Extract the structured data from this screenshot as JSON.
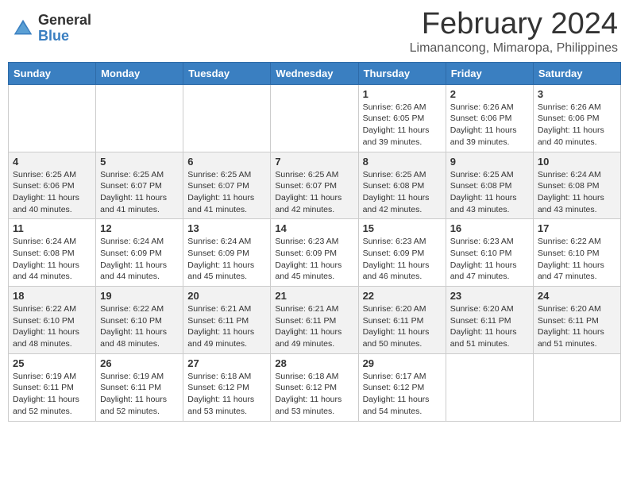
{
  "header": {
    "logo_general": "General",
    "logo_blue": "Blue",
    "title": "February 2024",
    "subtitle": "Limanancong, Mimaropa, Philippines"
  },
  "weekdays": [
    "Sunday",
    "Monday",
    "Tuesday",
    "Wednesday",
    "Thursday",
    "Friday",
    "Saturday"
  ],
  "weeks": [
    [
      {
        "day": "",
        "info": ""
      },
      {
        "day": "",
        "info": ""
      },
      {
        "day": "",
        "info": ""
      },
      {
        "day": "",
        "info": ""
      },
      {
        "day": "1",
        "info": "Sunrise: 6:26 AM\nSunset: 6:05 PM\nDaylight: 11 hours and 39 minutes."
      },
      {
        "day": "2",
        "info": "Sunrise: 6:26 AM\nSunset: 6:06 PM\nDaylight: 11 hours and 39 minutes."
      },
      {
        "day": "3",
        "info": "Sunrise: 6:26 AM\nSunset: 6:06 PM\nDaylight: 11 hours and 40 minutes."
      }
    ],
    [
      {
        "day": "4",
        "info": "Sunrise: 6:25 AM\nSunset: 6:06 PM\nDaylight: 11 hours and 40 minutes."
      },
      {
        "day": "5",
        "info": "Sunrise: 6:25 AM\nSunset: 6:07 PM\nDaylight: 11 hours and 41 minutes."
      },
      {
        "day": "6",
        "info": "Sunrise: 6:25 AM\nSunset: 6:07 PM\nDaylight: 11 hours and 41 minutes."
      },
      {
        "day": "7",
        "info": "Sunrise: 6:25 AM\nSunset: 6:07 PM\nDaylight: 11 hours and 42 minutes."
      },
      {
        "day": "8",
        "info": "Sunrise: 6:25 AM\nSunset: 6:08 PM\nDaylight: 11 hours and 42 minutes."
      },
      {
        "day": "9",
        "info": "Sunrise: 6:25 AM\nSunset: 6:08 PM\nDaylight: 11 hours and 43 minutes."
      },
      {
        "day": "10",
        "info": "Sunrise: 6:24 AM\nSunset: 6:08 PM\nDaylight: 11 hours and 43 minutes."
      }
    ],
    [
      {
        "day": "11",
        "info": "Sunrise: 6:24 AM\nSunset: 6:08 PM\nDaylight: 11 hours and 44 minutes."
      },
      {
        "day": "12",
        "info": "Sunrise: 6:24 AM\nSunset: 6:09 PM\nDaylight: 11 hours and 44 minutes."
      },
      {
        "day": "13",
        "info": "Sunrise: 6:24 AM\nSunset: 6:09 PM\nDaylight: 11 hours and 45 minutes."
      },
      {
        "day": "14",
        "info": "Sunrise: 6:23 AM\nSunset: 6:09 PM\nDaylight: 11 hours and 45 minutes."
      },
      {
        "day": "15",
        "info": "Sunrise: 6:23 AM\nSunset: 6:09 PM\nDaylight: 11 hours and 46 minutes."
      },
      {
        "day": "16",
        "info": "Sunrise: 6:23 AM\nSunset: 6:10 PM\nDaylight: 11 hours and 47 minutes."
      },
      {
        "day": "17",
        "info": "Sunrise: 6:22 AM\nSunset: 6:10 PM\nDaylight: 11 hours and 47 minutes."
      }
    ],
    [
      {
        "day": "18",
        "info": "Sunrise: 6:22 AM\nSunset: 6:10 PM\nDaylight: 11 hours and 48 minutes."
      },
      {
        "day": "19",
        "info": "Sunrise: 6:22 AM\nSunset: 6:10 PM\nDaylight: 11 hours and 48 minutes."
      },
      {
        "day": "20",
        "info": "Sunrise: 6:21 AM\nSunset: 6:11 PM\nDaylight: 11 hours and 49 minutes."
      },
      {
        "day": "21",
        "info": "Sunrise: 6:21 AM\nSunset: 6:11 PM\nDaylight: 11 hours and 49 minutes."
      },
      {
        "day": "22",
        "info": "Sunrise: 6:20 AM\nSunset: 6:11 PM\nDaylight: 11 hours and 50 minutes."
      },
      {
        "day": "23",
        "info": "Sunrise: 6:20 AM\nSunset: 6:11 PM\nDaylight: 11 hours and 51 minutes."
      },
      {
        "day": "24",
        "info": "Sunrise: 6:20 AM\nSunset: 6:11 PM\nDaylight: 11 hours and 51 minutes."
      }
    ],
    [
      {
        "day": "25",
        "info": "Sunrise: 6:19 AM\nSunset: 6:11 PM\nDaylight: 11 hours and 52 minutes."
      },
      {
        "day": "26",
        "info": "Sunrise: 6:19 AM\nSunset: 6:11 PM\nDaylight: 11 hours and 52 minutes."
      },
      {
        "day": "27",
        "info": "Sunrise: 6:18 AM\nSunset: 6:12 PM\nDaylight: 11 hours and 53 minutes."
      },
      {
        "day": "28",
        "info": "Sunrise: 6:18 AM\nSunset: 6:12 PM\nDaylight: 11 hours and 53 minutes."
      },
      {
        "day": "29",
        "info": "Sunrise: 6:17 AM\nSunset: 6:12 PM\nDaylight: 11 hours and 54 minutes."
      },
      {
        "day": "",
        "info": ""
      },
      {
        "day": "",
        "info": ""
      }
    ]
  ]
}
